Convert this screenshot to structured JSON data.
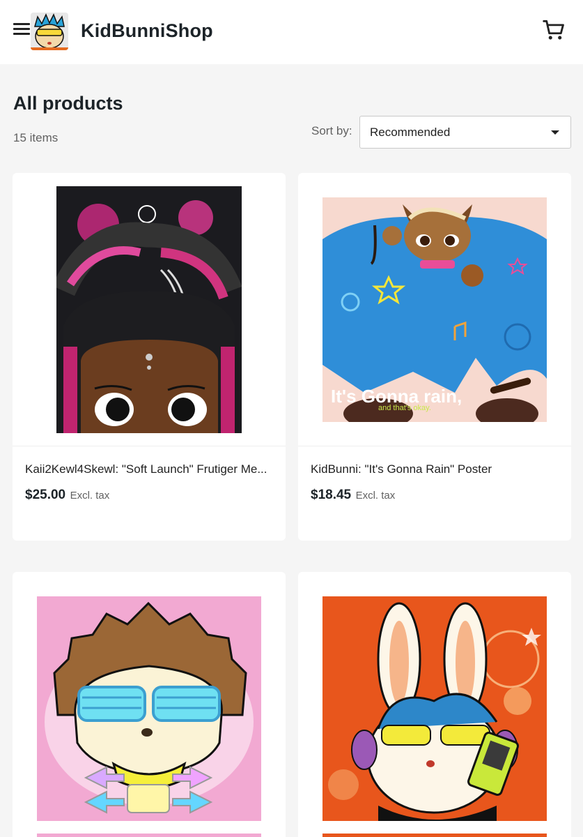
{
  "header": {
    "shop_name": "KidBunniShop"
  },
  "icons": {
    "menu": "hamburger-menu-icon",
    "cart": "shopping-cart-icon",
    "sort_caret": "chevron-down-icon"
  },
  "listing": {
    "title": "All products",
    "count": "15 items",
    "sort_label": "Sort by:",
    "sort_value": "Recommended"
  },
  "products": [
    {
      "name": "Kaii2Kewl4Skewl: \"Soft Launch\" Frutiger Me...",
      "price": "$25.00",
      "tax": "Excl. tax"
    },
    {
      "name": "KidBunni: \"It's Gonna Rain\" Poster",
      "price": "$18.45",
      "tax": "Excl. tax",
      "art_text_main": "It's Gonna rain,",
      "art_text_sub": "and that's okay."
    },
    {
      "name": "",
      "price": "",
      "tax": ""
    },
    {
      "name": "",
      "price": "",
      "tax": ""
    }
  ],
  "colors": {
    "header_bg": "#ffffff",
    "page_bg": "#f5f5f5",
    "text_dark": "#1c2328",
    "text_muted": "#616161"
  }
}
